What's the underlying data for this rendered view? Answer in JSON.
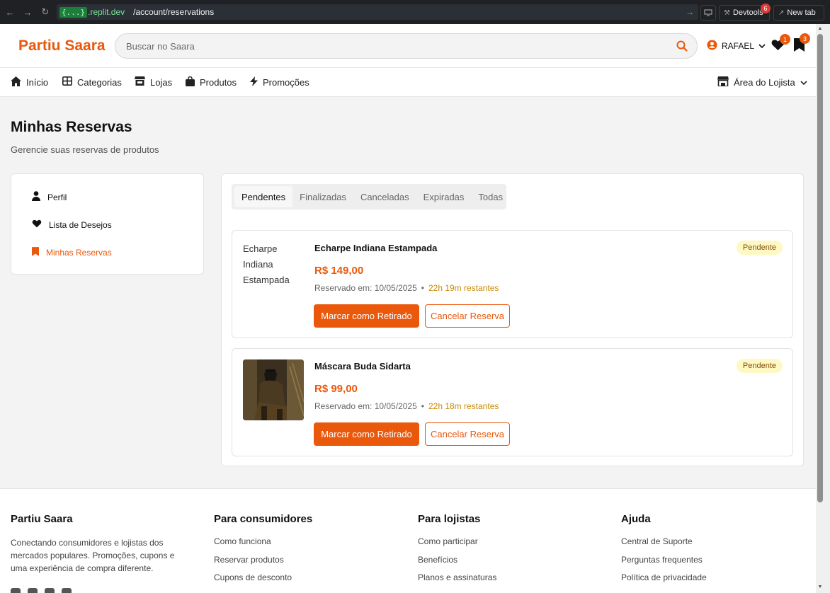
{
  "browser": {
    "domain_tag": "{...}",
    "domain_rest": ".replit.dev",
    "path": "/account/reservations",
    "devtools_label": "Devtools",
    "devtools_badge": "6",
    "newtab_label": "New tab"
  },
  "header": {
    "logo": "Partiu Saara",
    "search_placeholder": "Buscar no Saara",
    "user_name": "RAFAEL",
    "wishlist_count": "1",
    "reservations_count": "3",
    "accent_color": "#ea580c"
  },
  "nav": {
    "items": [
      {
        "label": "Início",
        "icon": "home-icon"
      },
      {
        "label": "Categorias",
        "icon": "grid-icon"
      },
      {
        "label": "Lojas",
        "icon": "store-icon"
      },
      {
        "label": "Produtos",
        "icon": "bag-icon"
      },
      {
        "label": "Promoções",
        "icon": "bolt-icon"
      }
    ],
    "merchant_area": "Área do Lojista"
  },
  "page": {
    "title": "Minhas Reservas",
    "subtitle": "Gerencie suas reservas de produtos"
  },
  "sidebar": {
    "items": [
      {
        "label": "Perfil",
        "icon": "user-icon"
      },
      {
        "label": "Lista de Desejos",
        "icon": "heart-icon"
      },
      {
        "label": "Minhas Reservas",
        "icon": "bookmark-icon",
        "active": true
      }
    ]
  },
  "tabs": [
    "Pendentes",
    "Finalizadas",
    "Canceladas",
    "Expiradas",
    "Todas"
  ],
  "reservations": [
    {
      "image_alt": "Echarpe Indiana Estampada",
      "title": "Echarpe Indiana Estampada",
      "price": "R$ 149,00",
      "reserved_at": "Reservado em: 10/05/2025",
      "separator": "•",
      "remaining": "22h 19m restantes",
      "status": "Pendente",
      "primary_action": "Marcar como Retirado",
      "secondary_action": "Cancelar Reserva"
    },
    {
      "image_alt": "Máscara Buda Sidarta",
      "title": "Máscara Buda Sidarta",
      "price": "R$ 99,00",
      "reserved_at": "Reservado em: 10/05/2025",
      "separator": "•",
      "remaining": "22h 18m restantes",
      "status": "Pendente",
      "primary_action": "Marcar como Retirado",
      "secondary_action": "Cancelar Reserva"
    }
  ],
  "footer": {
    "brand": {
      "title": "Partiu Saara",
      "description": "Conectando consumidores e lojistas dos mercados populares. Promoções, cupons e uma experiência de compra diferente."
    },
    "columns": [
      {
        "title": "Para consumidores",
        "links": [
          "Como funciona",
          "Reservar produtos",
          "Cupons de desconto"
        ]
      },
      {
        "title": "Para lojistas",
        "links": [
          "Como participar",
          "Benefícios",
          "Planos e assinaturas"
        ]
      },
      {
        "title": "Ajuda",
        "links": [
          "Central de Suporte",
          "Perguntas frequentes",
          "Política de privacidade"
        ]
      }
    ]
  }
}
